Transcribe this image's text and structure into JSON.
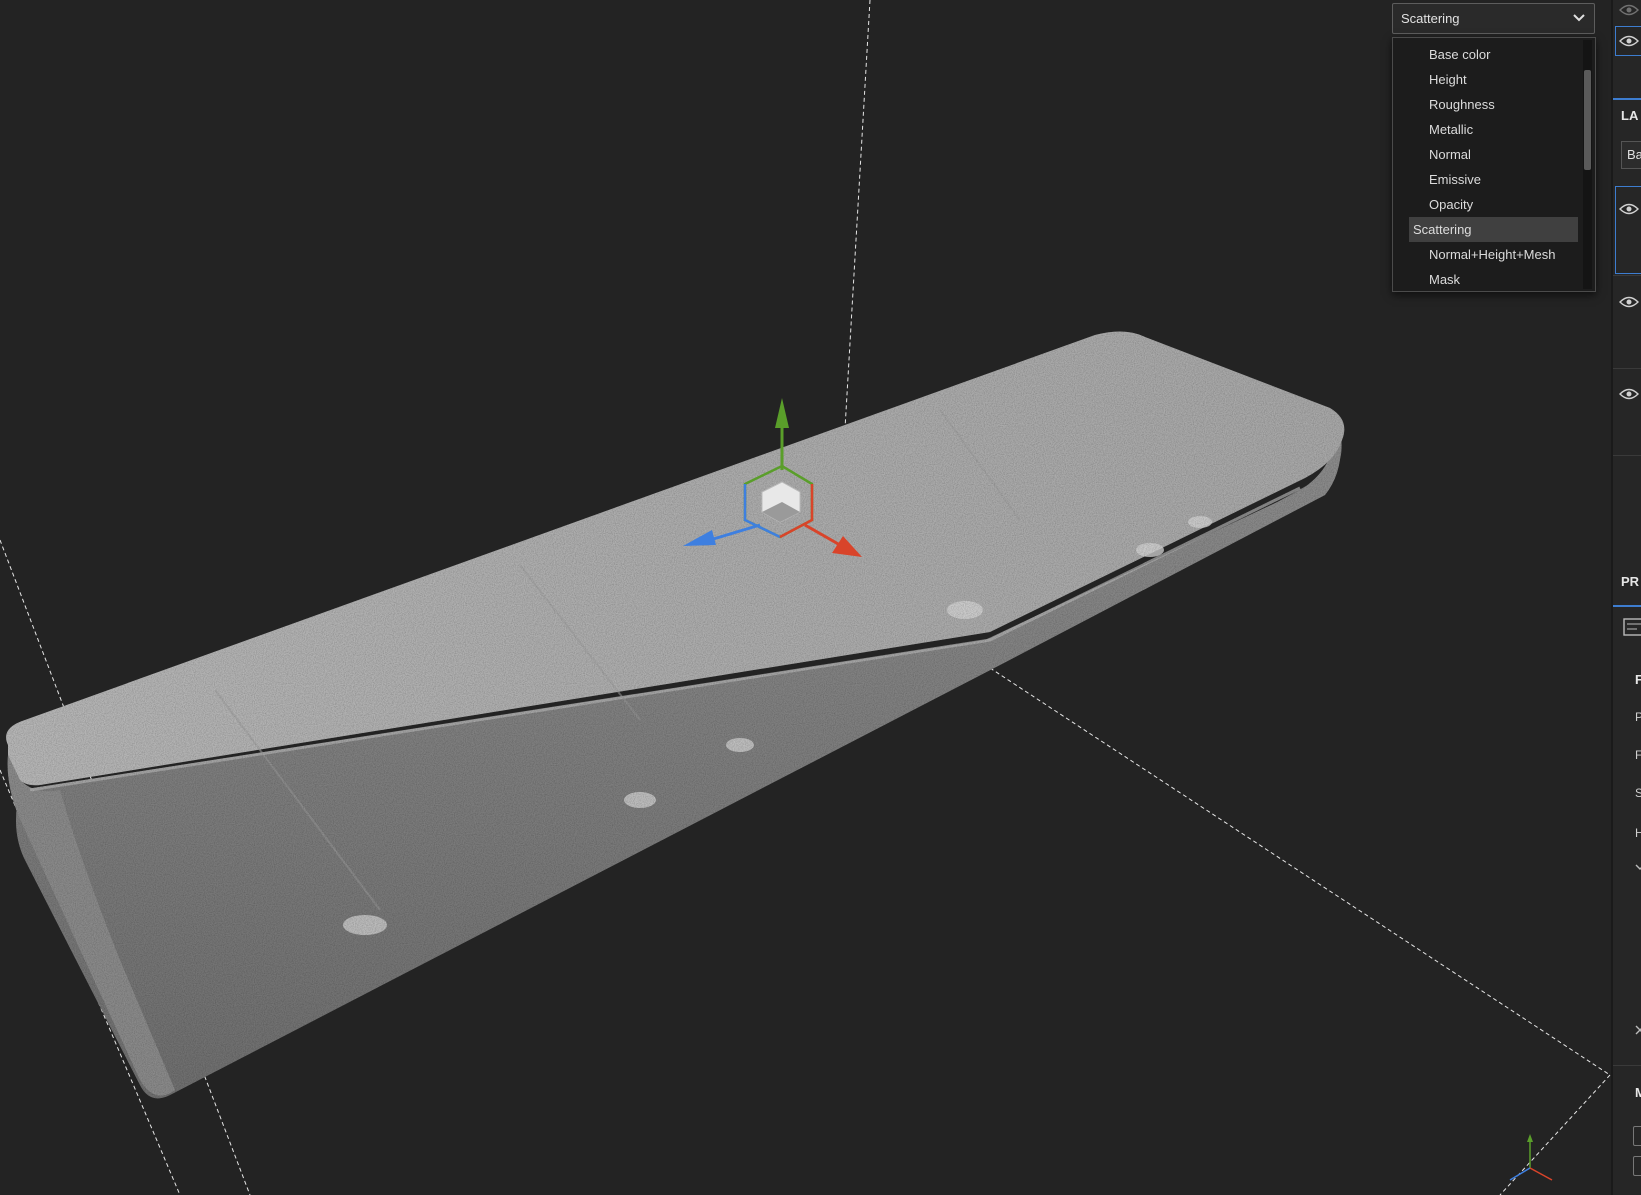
{
  "channel_dropdown": {
    "selected": "Scattering",
    "options": [
      "Base color",
      "Height",
      "Roughness",
      "Metallic",
      "Normal",
      "Emissive",
      "Opacity",
      "Scattering",
      "Normal+Height+Mesh",
      "Mask"
    ],
    "selected_index": 7
  },
  "right_panel": {
    "layers_title": "LA",
    "layer_search_value": "Ba",
    "properties_title": "PR",
    "prop_section": "F",
    "prop_rows": [
      "P",
      "F",
      "S",
      "H"
    ],
    "bottom_section": "M"
  },
  "colors": {
    "accent": "#3d7dd0",
    "gizmo_x": "#d9442a",
    "gizmo_y": "#5a9e2a",
    "gizmo_z": "#3e7fe0",
    "viewport_bg": "#232323"
  }
}
